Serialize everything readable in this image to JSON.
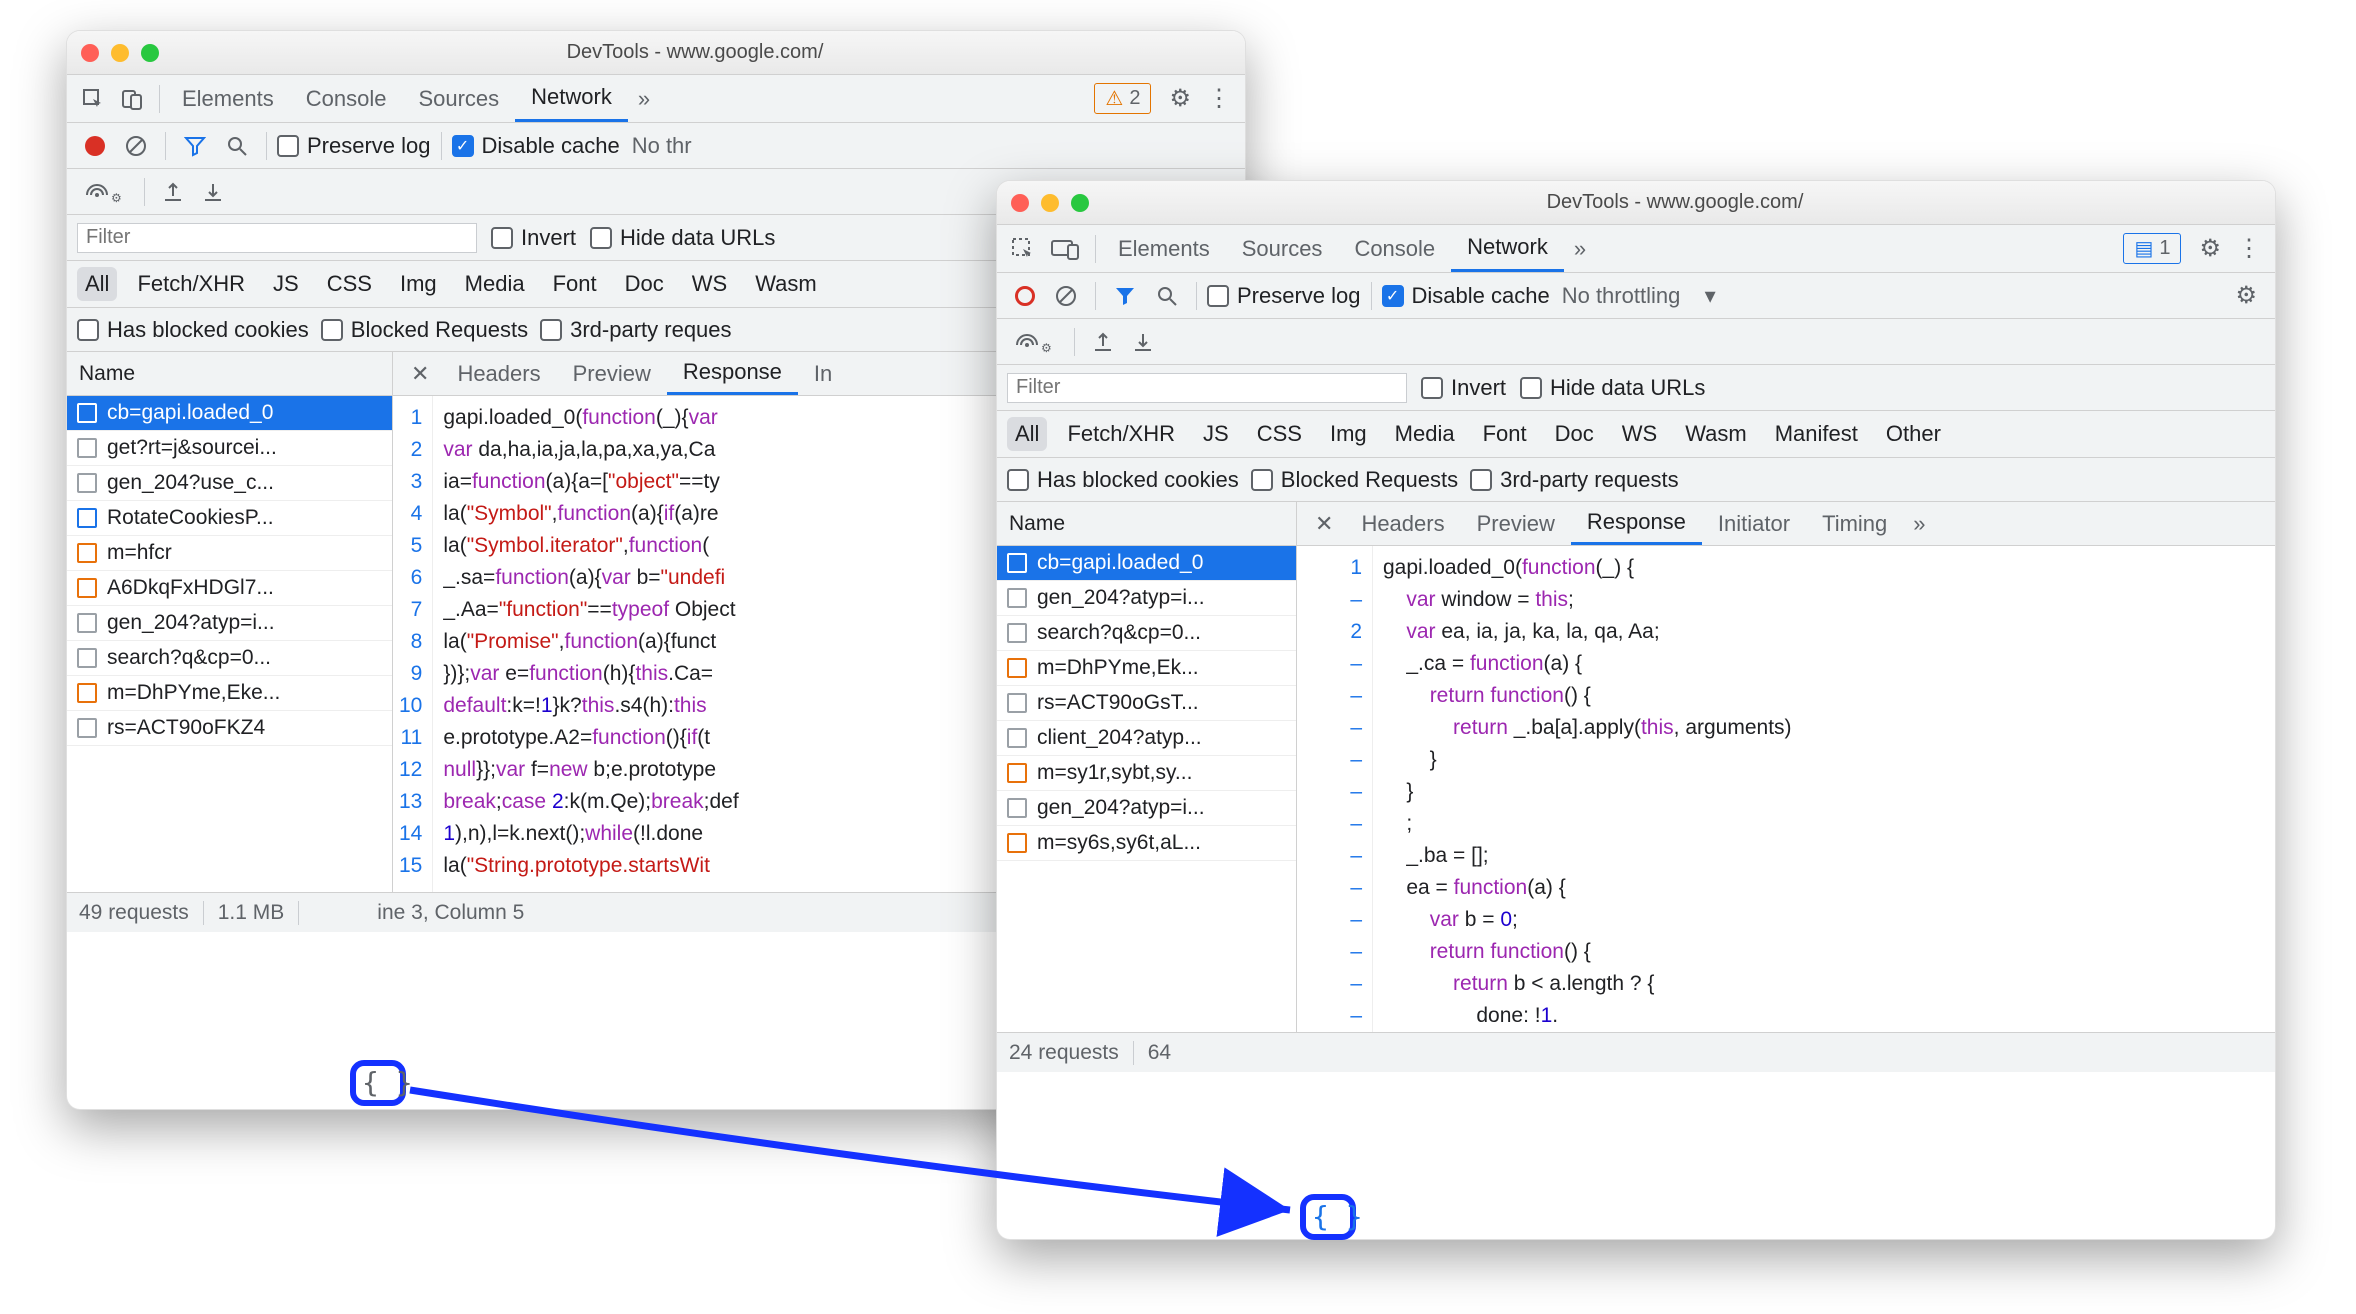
{
  "window_title": "DevTools - www.google.com/",
  "panel_tabs": {
    "w1": [
      "Elements",
      "Console",
      "Sources",
      "Network"
    ],
    "w2": [
      "Elements",
      "Sources",
      "Console",
      "Network"
    ],
    "active": "Network"
  },
  "more_tabs": "»",
  "warn_badge": "2",
  "msg_badge": "1",
  "net_toolbar": {
    "preserve_log": "Preserve log",
    "disable_cache": "Disable cache",
    "throttling_w1": "No thr",
    "throttling_w2": "No throttling"
  },
  "filter_placeholder": "Filter",
  "invert": "Invert",
  "hide_data": "Hide data URLs",
  "types": [
    "All",
    "Fetch/XHR",
    "JS",
    "CSS",
    "Img",
    "Media",
    "Font",
    "Doc",
    "WS",
    "Wasm",
    "Manifest",
    "Other"
  ],
  "type_opts": {
    "blocked_cookies": "Has blocked cookies",
    "blocked_req": "Blocked Requests",
    "third_party_w1": "3rd-party reques",
    "third_party_w2": "3rd-party requests"
  },
  "side_hdr": "Name",
  "content_tabs": [
    "Headers",
    "Preview",
    "Response",
    "Initiator",
    "Timing"
  ],
  "content_tabs_w1_visible": [
    "Headers",
    "Preview",
    "Response",
    "In"
  ],
  "content_active": "Response",
  "w1": {
    "requests": [
      {
        "icon": "orange",
        "label": "cb=gapi.loaded_0",
        "sel": true
      },
      {
        "icon": "grey",
        "label": "get?rt=j&sourcei..."
      },
      {
        "icon": "grey",
        "label": "gen_204?use_c..."
      },
      {
        "icon": "blue",
        "label": "RotateCookiesP..."
      },
      {
        "icon": "orange",
        "label": "m=hfcr"
      },
      {
        "icon": "orange",
        "label": "A6DkqFxHDGl7..."
      },
      {
        "icon": "grey",
        "label": "gen_204?atyp=i..."
      },
      {
        "icon": "grey",
        "label": "search?q&cp=0..."
      },
      {
        "icon": "orange",
        "label": "m=DhPYme,Eke..."
      },
      {
        "icon": "grey",
        "label": "rs=ACT90oFKZ4"
      }
    ],
    "status_requests": "49 requests",
    "status_size": "1.1 MB",
    "status_cursor": "ine 3, Column 5",
    "gutter": [
      "1",
      "2",
      "3",
      "4",
      "5",
      "6",
      "7",
      "8",
      "9",
      "10",
      "11",
      "12",
      "13",
      "14",
      "15"
    ],
    "code_lines": [
      {
        "segs": [
          {
            "t": "gapi.loaded_0("
          },
          {
            "t": "function",
            "c": "kw"
          },
          {
            "t": "(_){"
          },
          {
            "t": "var",
            "c": "kw"
          }
        ]
      },
      {
        "segs": [
          {
            "t": "var",
            "c": "kw"
          },
          {
            "t": " da,ha,ia,ja,la,pa,xa,ya,Ca"
          }
        ]
      },
      {
        "segs": [
          {
            "t": "ia="
          },
          {
            "t": "function",
            "c": "kw"
          },
          {
            "t": "(a){a=["
          },
          {
            "t": "\"object\"",
            "c": "str"
          },
          {
            "t": "==ty"
          }
        ]
      },
      {
        "segs": [
          {
            "t": "la("
          },
          {
            "t": "\"Symbol\"",
            "c": "str"
          },
          {
            "t": ","
          },
          {
            "t": "function",
            "c": "kw"
          },
          {
            "t": "(a){"
          },
          {
            "t": "if",
            "c": "kw"
          },
          {
            "t": "(a)re"
          }
        ]
      },
      {
        "segs": [
          {
            "t": "la("
          },
          {
            "t": "\"Symbol.iterator\"",
            "c": "str"
          },
          {
            "t": ","
          },
          {
            "t": "function",
            "c": "kw"
          },
          {
            "t": "("
          }
        ]
      },
      {
        "segs": [
          {
            "t": "_.sa="
          },
          {
            "t": "function",
            "c": "kw"
          },
          {
            "t": "(a){"
          },
          {
            "t": "var",
            "c": "kw"
          },
          {
            "t": " b="
          },
          {
            "t": "\"undefi",
            "c": "str"
          }
        ]
      },
      {
        "segs": [
          {
            "t": "_.Aa="
          },
          {
            "t": "\"function\"",
            "c": "str"
          },
          {
            "t": "=="
          },
          {
            "t": "typeof",
            "c": "kw"
          },
          {
            "t": " Object"
          }
        ]
      },
      {
        "segs": [
          {
            "t": "la("
          },
          {
            "t": "\"Promise\"",
            "c": "str"
          },
          {
            "t": ","
          },
          {
            "t": "function",
            "c": "kw"
          },
          {
            "t": "(a){funct"
          }
        ]
      },
      {
        "segs": [
          {
            "t": "})};"
          },
          {
            "t": "var",
            "c": "kw"
          },
          {
            "t": " e="
          },
          {
            "t": "function",
            "c": "kw"
          },
          {
            "t": "(h){"
          },
          {
            "t": "this",
            "c": "kw"
          },
          {
            "t": ".Ca="
          }
        ]
      },
      {
        "segs": [
          {
            "t": "default",
            "c": "kw"
          },
          {
            "t": ":k=!"
          },
          {
            "t": "1",
            "c": "num2"
          },
          {
            "t": "}k?"
          },
          {
            "t": "this",
            "c": "kw"
          },
          {
            "t": ".s4(h):"
          },
          {
            "t": "this",
            "c": "kw"
          }
        ]
      },
      {
        "segs": [
          {
            "t": "e.prototype.A2="
          },
          {
            "t": "function",
            "c": "kw"
          },
          {
            "t": "(){"
          },
          {
            "t": "if",
            "c": "kw"
          },
          {
            "t": "(t"
          }
        ]
      },
      {
        "segs": [
          {
            "t": "null",
            "c": "kw"
          },
          {
            "t": "}};"
          },
          {
            "t": "var",
            "c": "kw"
          },
          {
            "t": " f="
          },
          {
            "t": "new",
            "c": "kw"
          },
          {
            "t": " b;e.prototype"
          }
        ]
      },
      {
        "segs": [
          {
            "t": "break",
            "c": "kw"
          },
          {
            "t": ";"
          },
          {
            "t": "case",
            "c": "kw"
          },
          {
            "t": " "
          },
          {
            "t": "2",
            "c": "num2"
          },
          {
            "t": ":k(m.Qe);"
          },
          {
            "t": "break",
            "c": "kw"
          },
          {
            "t": ";def"
          }
        ]
      },
      {
        "segs": [
          {
            "t": "1",
            "c": "num2"
          },
          {
            "t": "),n),l=k.next();"
          },
          {
            "t": "while",
            "c": "kw"
          },
          {
            "t": "(!l.done"
          }
        ]
      },
      {
        "segs": [
          {
            "t": "la("
          },
          {
            "t": "\"String.prototype.startsWit",
            "c": "str"
          }
        ]
      }
    ]
  },
  "w2": {
    "requests": [
      {
        "icon": "orange",
        "label": "cb=gapi.loaded_0",
        "sel": true
      },
      {
        "icon": "grey",
        "label": "gen_204?atyp=i..."
      },
      {
        "icon": "grey",
        "label": "search?q&cp=0..."
      },
      {
        "icon": "orange",
        "label": "m=DhPYme,Ek..."
      },
      {
        "icon": "grey",
        "label": "rs=ACT90oGsT..."
      },
      {
        "icon": "grey",
        "label": "client_204?atyp..."
      },
      {
        "icon": "orange",
        "label": "m=sy1r,sybt,sy..."
      },
      {
        "icon": "grey",
        "label": "gen_204?atyp=i..."
      },
      {
        "icon": "orange",
        "label": "m=sy6s,sy6t,aL..."
      }
    ],
    "status_requests": "24 requests",
    "status_size": "64",
    "gutter": [
      "1",
      "–",
      "2",
      "–",
      "–",
      "–",
      "–",
      "–",
      "–",
      "–",
      "–",
      "–",
      "–",
      "–",
      "–"
    ],
    "code_lines": [
      {
        "segs": [
          {
            "t": "gapi.loaded_0("
          },
          {
            "t": "function",
            "c": "kw"
          },
          {
            "t": "(_) {"
          }
        ]
      },
      {
        "segs": [
          {
            "t": "    "
          },
          {
            "t": "var",
            "c": "kw"
          },
          {
            "t": " window = "
          },
          {
            "t": "this",
            "c": "kw"
          },
          {
            "t": ";"
          }
        ]
      },
      {
        "segs": [
          {
            "t": "    "
          },
          {
            "t": "var",
            "c": "kw"
          },
          {
            "t": " ea, ia, ja, ka, la, qa, Aa;"
          }
        ]
      },
      {
        "segs": [
          {
            "t": "    _.ca = "
          },
          {
            "t": "function",
            "c": "kw"
          },
          {
            "t": "(a) {"
          }
        ]
      },
      {
        "segs": [
          {
            "t": "        "
          },
          {
            "t": "return",
            "c": "kw"
          },
          {
            "t": " "
          },
          {
            "t": "function",
            "c": "kw"
          },
          {
            "t": "() {"
          }
        ]
      },
      {
        "segs": [
          {
            "t": "            "
          },
          {
            "t": "return",
            "c": "kw"
          },
          {
            "t": " _.ba[a].apply("
          },
          {
            "t": "this",
            "c": "kw"
          },
          {
            "t": ", arguments)"
          }
        ]
      },
      {
        "segs": [
          {
            "t": "        }"
          }
        ]
      },
      {
        "segs": [
          {
            "t": "    }"
          }
        ]
      },
      {
        "segs": [
          {
            "t": "    ;"
          }
        ]
      },
      {
        "segs": [
          {
            "t": "    _.ba = [];"
          }
        ]
      },
      {
        "segs": [
          {
            "t": "    ea = "
          },
          {
            "t": "function",
            "c": "kw"
          },
          {
            "t": "(a) {"
          }
        ]
      },
      {
        "segs": [
          {
            "t": "        "
          },
          {
            "t": "var",
            "c": "kw"
          },
          {
            "t": " b = "
          },
          {
            "t": "0",
            "c": "num2"
          },
          {
            "t": ";"
          }
        ]
      },
      {
        "segs": [
          {
            "t": "        "
          },
          {
            "t": "return",
            "c": "kw"
          },
          {
            "t": " "
          },
          {
            "t": "function",
            "c": "kw"
          },
          {
            "t": "() {"
          }
        ]
      },
      {
        "segs": [
          {
            "t": "            "
          },
          {
            "t": "return",
            "c": "kw"
          },
          {
            "t": " b < a.length ? {"
          }
        ]
      },
      {
        "segs": [
          {
            "t": "                done: !"
          },
          {
            "t": "1",
            "c": "num2"
          },
          {
            "t": "."
          }
        ]
      }
    ]
  }
}
